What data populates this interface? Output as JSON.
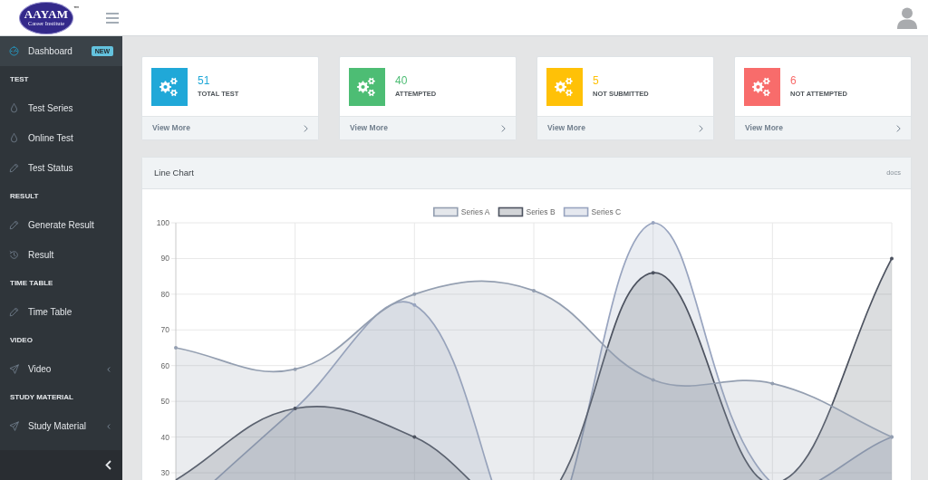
{
  "header": {
    "logo": {
      "name": "AAYAM",
      "tagline": "Career Institute",
      "trademark": "™"
    }
  },
  "sidebar": {
    "items": [
      {
        "kind": "link",
        "label": "Dashboard",
        "badge": "NEW",
        "selected": true
      },
      {
        "kind": "title",
        "label": "TEST"
      },
      {
        "kind": "link",
        "label": "Test Series",
        "selected": false
      },
      {
        "kind": "link",
        "label": "Online Test",
        "selected": false
      },
      {
        "kind": "link",
        "label": "Test Status",
        "selected": false
      },
      {
        "kind": "title",
        "label": "RESULT"
      },
      {
        "kind": "link",
        "label": "Generate Result",
        "selected": false
      },
      {
        "kind": "link",
        "label": "Result",
        "selected": false
      },
      {
        "kind": "title",
        "label": "TIME TABLE"
      },
      {
        "kind": "link",
        "label": "Time Table",
        "selected": false
      },
      {
        "kind": "title",
        "label": "VIDEO"
      },
      {
        "kind": "dropdown",
        "label": "Video",
        "selected": false,
        "expanded": false
      },
      {
        "kind": "title",
        "label": "STUDY MATERIAL"
      },
      {
        "kind": "dropdown",
        "label": "Study Material",
        "selected": false,
        "expanded": false
      }
    ]
  },
  "stats": [
    {
      "value": "51",
      "label": "TOTAL TEST",
      "color": "#20a8d8",
      "link": "View More"
    },
    {
      "value": "40",
      "label": "ATTEMPTED",
      "color": "#4dbd74",
      "link": "View More"
    },
    {
      "value": "5",
      "label": "NOT SUBMITTED",
      "color": "#ffc107",
      "link": "View More"
    },
    {
      "value": "6",
      "label": "NOT ATTEMPTED",
      "color": "#f86c6b",
      "link": "View More"
    }
  ],
  "chart_card": {
    "title": "Line Chart",
    "action": "docs",
    "chart_data": {
      "type": "area",
      "grid": true,
      "legend": "top",
      "ylim": [
        0,
        100
      ],
      "yticks": [
        30,
        40,
        50,
        60,
        70,
        80,
        90,
        100
      ],
      "series": [
        {
          "name": "Series A",
          "color": "#949fb1",
          "values": [
            65,
            59,
            80,
            81,
            56,
            55,
            40
          ]
        },
        {
          "name": "Series B",
          "color": "#4d5360",
          "values": [
            28,
            48,
            40,
            19,
            86,
            27,
            90
          ]
        },
        {
          "name": "Series C",
          "color": "#98a4bf",
          "values": [
            18,
            48,
            77,
            9,
            100,
            27,
            40
          ]
        }
      ]
    }
  }
}
